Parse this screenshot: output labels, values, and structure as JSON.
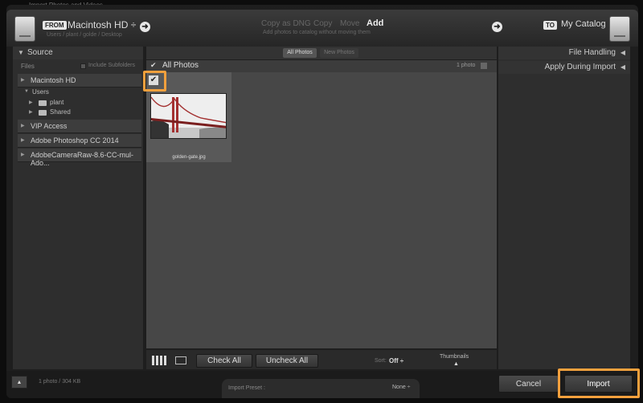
{
  "window_title": "Import Photos and Videos",
  "from": {
    "tag": "FROM",
    "source": "Macintosh HD ÷",
    "path": "Users / plant / golde / Desktop"
  },
  "modes": {
    "copy_dng": "Copy as DNG",
    "copy": "Copy",
    "move": "Move",
    "add": "Add",
    "subtitle": "Add photos to catalog without moving them"
  },
  "to": {
    "tag": "TO",
    "catalog": "My Catalog"
  },
  "source_panel": {
    "title": "Source",
    "files": "Files",
    "include_subfolders": "Include Subfolders",
    "items": [
      {
        "label": "Macintosh HD"
      },
      {
        "label": "Users"
      },
      {
        "label": "plant"
      },
      {
        "label": "Shared"
      },
      {
        "label": "VIP Access"
      },
      {
        "label": "Adobe Photoshop CC 2014"
      },
      {
        "label": "AdobeCameraRaw-8.6-CC-mul-Ado..."
      }
    ]
  },
  "tabs": {
    "all": "All Photos",
    "new": "New Photos"
  },
  "grid": {
    "header": "All Photos",
    "count": "1 photo",
    "photo_name": "golden-gate.jpg"
  },
  "toolbar": {
    "check_all": "Check All",
    "uncheck_all": "Uncheck All",
    "sort_label": "Sort:",
    "sort_value": "Off ÷",
    "thumbnails": "Thumbnails"
  },
  "right_panel": {
    "file_handling": "File Handling",
    "apply_during": "Apply During Import"
  },
  "footer": {
    "status": "1 photo / 304 KB",
    "preset_label": "Import Preset :",
    "preset_value": "None ÷",
    "cancel": "Cancel",
    "import": "Import"
  },
  "colors": {
    "accent": "#f2a03d"
  }
}
